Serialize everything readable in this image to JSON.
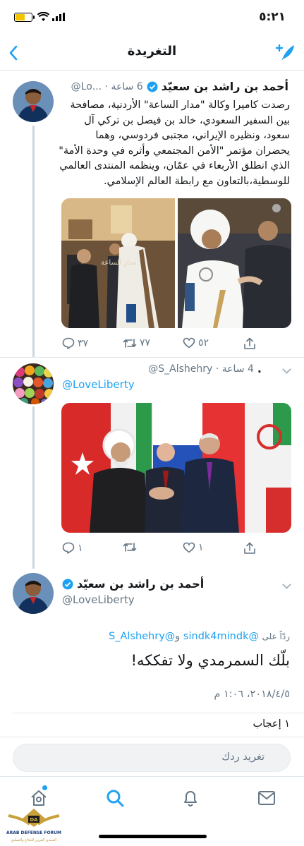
{
  "status_bar": {
    "time": "٥:٢١",
    "battery_icon": "battery-low-icon",
    "wifi_icon": "wifi-icon",
    "signal_icon": "signal-icon"
  },
  "header": {
    "title": "التغريدة",
    "back_icon": "chevron-left-icon",
    "compose_icon": "compose-feather-icon"
  },
  "tweets": [
    {
      "name": "أحمد بن راشد بن سعيّد",
      "handle_time": "6 ساعة · ...Lo@",
      "verified": true,
      "text_lines": [
        "رصدت كاميرا وكالة \"مدار الساعة\" الأردنية، مصافحة",
        "بين السفير السعودي، خالد بن فيصل بن تركي آل",
        "سعود، ونظيره الإيراني، مجتبى فردوسي، وهما",
        "يحضران مؤتمر \"الأمن المجتمعي وأثره في وحدة الأمة\"",
        "الذي انطلق الأربعاء في عمّان، وينظمه المنتدى العالمي",
        "للوسطية،بالتعاون مع رابطة العالم الإسلامي."
      ],
      "actions": {
        "replies": "٣٧",
        "retweets": "٧٧",
        "likes": "٥٢"
      }
    },
    {
      "name": ".",
      "handle_time": "4 ساعة · S_Alshehry@",
      "mention": "@LoveLiberty",
      "actions": {
        "replies": "١",
        "retweets": "",
        "likes": "١"
      }
    }
  ],
  "main_tweet": {
    "name": "أحمد بن راشد بن سعيّد",
    "handle": "@LoveLiberty",
    "verified": true,
    "reply_prefix": "ردّاً على",
    "reply_to_1": "@sindk4mindk",
    "reply_joiner": "و",
    "reply_to_2": "@S_Alshehry",
    "text": "بلّك السمرمدي ولا تفككه!",
    "timestamp": "٢٠١٨/٤/٥، ١:٠٦ م",
    "likes": "١ إعجاب"
  },
  "reply_box": {
    "placeholder": "تغريد ردك"
  },
  "tabbar": {
    "items": [
      "home-icon",
      "search-icon",
      "notifications-icon",
      "messages-icon"
    ]
  },
  "watermark": {
    "line1": "ARAB DEFENSE FORUM",
    "line2": "المنتدى العربي للدفاع والتسليح"
  },
  "colors": {
    "accent": "#1da1f2",
    "muted": "#657786",
    "divider": "#e1e8ed"
  }
}
